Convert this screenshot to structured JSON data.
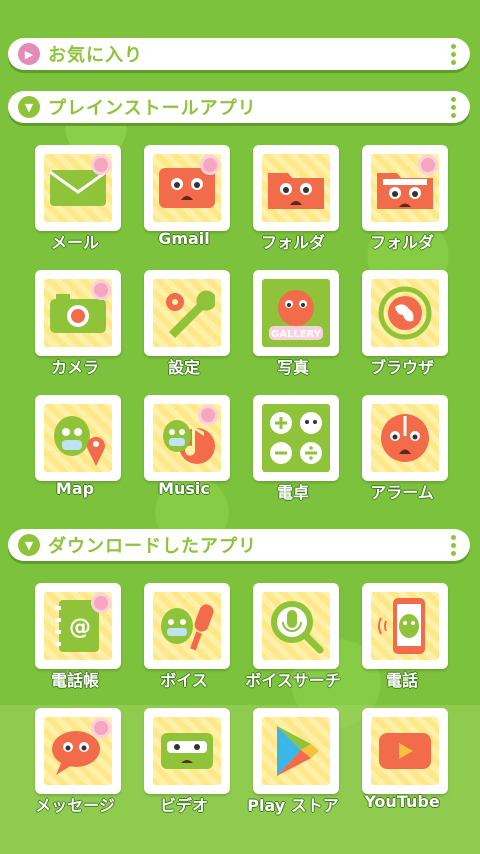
{
  "sections": {
    "favorites": {
      "label": "お気に入り"
    },
    "preinstalled": {
      "label": "プレインストールアプリ"
    },
    "downloaded": {
      "label": "ダウンロードしたアプリ"
    }
  },
  "colors": {
    "background": "#7cc23c",
    "accent_green": "#8fc33a",
    "favorites_circle": "#e48bb8",
    "section_circle": "#8fc33a",
    "tile_orange": "#f26b4b",
    "tile_green": "#8fc33a"
  },
  "preinstalled_apps": [
    {
      "label": "メール",
      "icon": "mail-envelope-icon"
    },
    {
      "label": "Gmail",
      "icon": "gmail-face-envelope-icon"
    },
    {
      "label": "フォルダ",
      "icon": "folder-face-icon"
    },
    {
      "label": "フォルダ",
      "icon": "folder-open-face-icon"
    },
    {
      "label": "カメラ",
      "icon": "camera-icon"
    },
    {
      "label": "設定",
      "icon": "gear-wrench-icon"
    },
    {
      "label": "写真",
      "icon": "gallery-character-icon",
      "text": "GALLERY"
    },
    {
      "label": "ブラウザ",
      "icon": "globe-icon"
    },
    {
      "label": "Map",
      "icon": "map-pin-character-icon"
    },
    {
      "label": "Music",
      "icon": "music-note-character-icon"
    },
    {
      "label": "電卓",
      "icon": "calculator-icon"
    },
    {
      "label": "アラーム",
      "icon": "alarm-face-icon"
    }
  ],
  "downloaded_apps": [
    {
      "label": "電話帳",
      "icon": "address-book-icon"
    },
    {
      "label": "ボイス",
      "icon": "microphone-character-icon"
    },
    {
      "label": "ボイスサーチ",
      "icon": "voice-search-icon"
    },
    {
      "label": "電話",
      "icon": "phone-character-icon"
    },
    {
      "label": "メッセージ",
      "icon": "message-bubble-icon"
    },
    {
      "label": "ビデオ",
      "icon": "video-character-icon"
    },
    {
      "label": "Play ストア",
      "icon": "play-store-icon"
    },
    {
      "label": "YouTube",
      "icon": "youtube-icon"
    }
  ]
}
